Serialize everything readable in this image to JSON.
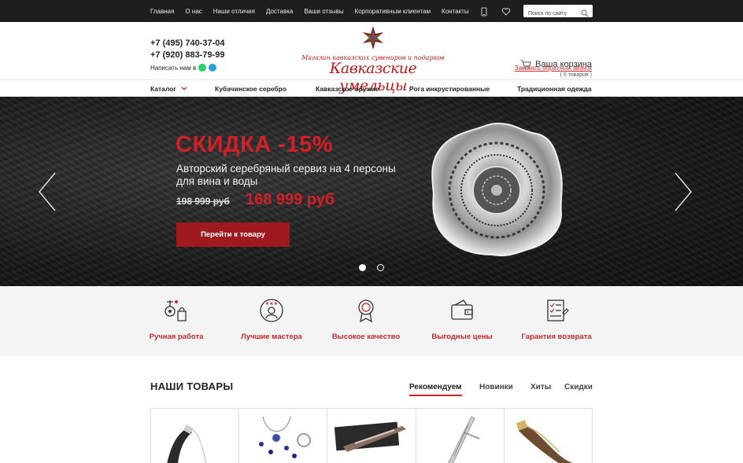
{
  "topbar": {
    "nav": [
      "Главная",
      "О нас",
      "Наши отличия",
      "Доставка",
      "Ваши отзывы",
      "Корпоративным клиентам",
      "Контакты"
    ],
    "search_placeholder": "Поиск по сайту",
    "icons": [
      "phone-icon",
      "heart-icon",
      "search-icon"
    ]
  },
  "header": {
    "phone1": "+7 (495) 740-37-04",
    "phone2": "+7 (920) 883-79-99",
    "write_us": "Написать нам в",
    "logo_tagline": "Магазин кавказских сувениров и подарков",
    "logo_brand": "Кавказские умельцы",
    "cart_label": "Ваша корзина",
    "cart_count": "( 0 товаров )",
    "callback": "Заказать обратный звонок"
  },
  "catnav": [
    "Каталог",
    "Кубачинское серебро",
    "Кавказское оружие",
    "Рога инкрустированные",
    "Традиционная одежда"
  ],
  "hero": {
    "title": "СКИДКА -15%",
    "subtitle": "Авторский серебряный сервиз на 4 персоны для вина и воды",
    "old_price": "198 999 руб",
    "new_price": "168 999 руб",
    "button": "Перейти к товару",
    "slides": 2,
    "active_slide": 1
  },
  "features": [
    "Ручная работа",
    "Лучшие мастера",
    "Высокое качество",
    "Выгодные цены",
    "Гарантия возврата"
  ],
  "products": {
    "heading": "НАШИ ТОВАРЫ",
    "tabs": [
      "Рекомендуем",
      "Новинки",
      "Хиты",
      "Скидки"
    ],
    "active_tab": "Рекомендуем"
  },
  "colors": {
    "accent": "#c62828",
    "topbar": "#1e1e1e",
    "button": "#9e1a1f"
  }
}
